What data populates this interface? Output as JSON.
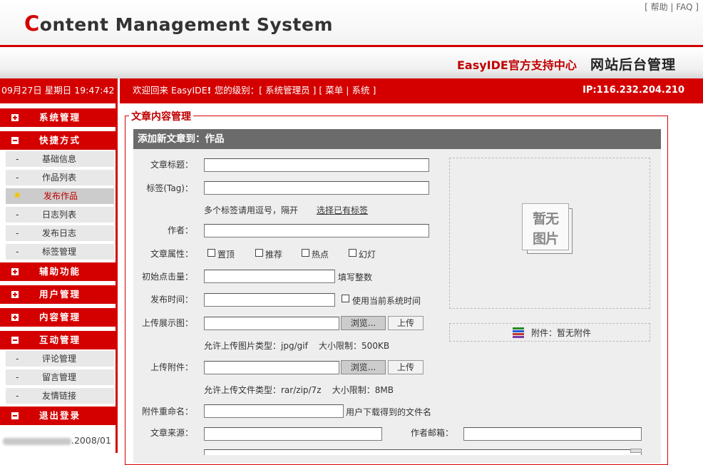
{
  "header": {
    "logo_first": "C",
    "logo_rest": "ontent Management System",
    "top_links": "[ 帮助 | FAQ ]",
    "support_center": "EasyIDE官方支持中心",
    "admin_title": "网站后台管理"
  },
  "statusbar": {
    "datetime": "09月27日 星期日 19:47:42",
    "welcome_prefix": "欢迎回来 EasyIDE",
    "welcome_level": "您的级别：[ 系统管理员 ] [",
    "menu_link": "菜单",
    "divider": "|",
    "system_link": "系统",
    "welcome_suffix": "]",
    "ip": "IP:116.232.204.210"
  },
  "sidebar": {
    "sections": [
      {
        "label": "系统管理"
      },
      {
        "label": "快捷方式"
      },
      {
        "label": "辅助功能"
      },
      {
        "label": "用户管理"
      },
      {
        "label": "内容管理"
      },
      {
        "label": "互动管理"
      },
      {
        "label": "退出登录"
      }
    ],
    "shortcut_items": [
      "基础信息",
      "作品列表",
      "发布作品",
      "日志列表",
      "发布日志",
      "标签管理"
    ],
    "interaction_items": [
      "评论管理",
      "留言管理",
      "友情链接"
    ],
    "item_dash": "-",
    "copyright_suffix": ".2008/01"
  },
  "main": {
    "legend": "文章内容管理",
    "form_title": "添加新文章到：作品",
    "labels": {
      "title": "文章标题：",
      "tag": "标签(Tag)：",
      "author": "作者：",
      "attributes": "文章属性：",
      "clicks": "初始点击量：",
      "publish_time": "发布时间：",
      "upload_image": "上传展示图：",
      "upload_attachment": "上传附件：",
      "rename_attachment": "附件重命名：",
      "source": "文章来源：",
      "author_email": "作者邮箱："
    },
    "notes": {
      "tag_hint": "多个标签请用逗号，隔开",
      "choose_tags": "选择已有标签",
      "clicks_hint": "填写整数",
      "use_current_time": "使用当前系统时间",
      "image_types": "允许上传图片类型：jpg/gif    大小限制：500KB",
      "file_types": "允许上传文件类型：rar/zip/7z    大小限制：8MB",
      "rename_hint": "用户下载得到的文件名"
    },
    "checkboxes": [
      "置顶",
      "推荐",
      "热点",
      "幻灯"
    ],
    "browse_button": "浏览...",
    "upload_button": "上传",
    "preview_placeholder_line1": "暂无",
    "preview_placeholder_line2": "图片",
    "attachment_status": "附件：暂无附件"
  },
  "colors": {
    "brand_red": "#d40000",
    "form_header_gray": "#6b6b6b"
  }
}
